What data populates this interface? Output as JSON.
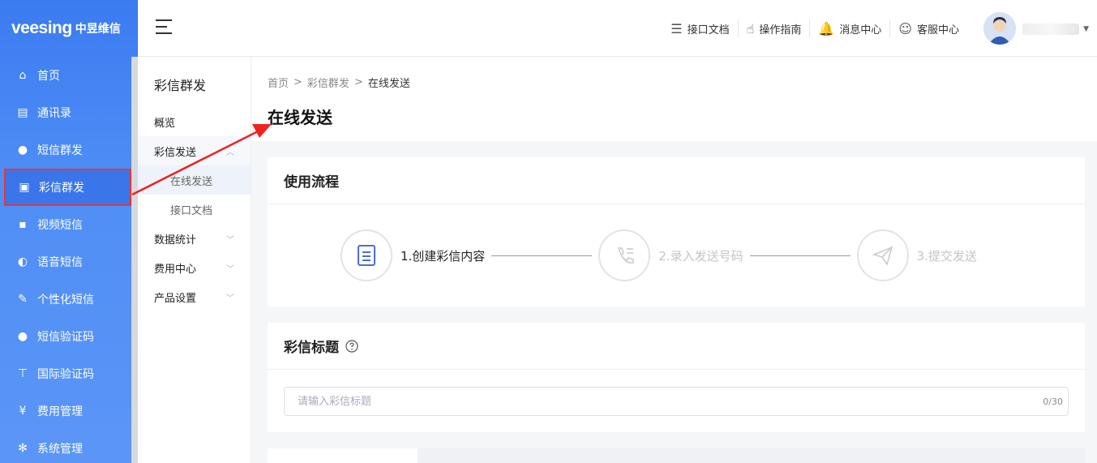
{
  "brand": {
    "logo_en": "veesing",
    "logo_cn": "中昱维信"
  },
  "sidebar": {
    "items": [
      {
        "label": "首页",
        "icon": "home-icon",
        "glyph": "⌂"
      },
      {
        "label": "通讯录",
        "icon": "contacts-icon",
        "glyph": "▤"
      },
      {
        "label": "短信群发",
        "icon": "sms-icon",
        "glyph": "●"
      },
      {
        "label": "彩信群发",
        "icon": "mms-icon",
        "glyph": "▣"
      },
      {
        "label": "视频短信",
        "icon": "video-sms-icon",
        "glyph": "▪"
      },
      {
        "label": "语音短信",
        "icon": "voice-sms-icon",
        "glyph": "◐"
      },
      {
        "label": "个性化短信",
        "icon": "personal-sms-icon",
        "glyph": "✎"
      },
      {
        "label": "短信验证码",
        "icon": "sms-code-icon",
        "glyph": "●"
      },
      {
        "label": "国际验证码",
        "icon": "intl-code-icon",
        "glyph": "⊤"
      },
      {
        "label": "费用管理",
        "icon": "billing-icon",
        "glyph": "¥"
      },
      {
        "label": "系统管理",
        "icon": "settings-icon",
        "glyph": "✻"
      }
    ],
    "active_index": 3
  },
  "header": {
    "links": [
      {
        "label": "接口文档",
        "icon": "api-doc-icon"
      },
      {
        "label": "操作指南",
        "icon": "guide-hand-icon"
      },
      {
        "label": "消息中心",
        "icon": "bell-icon"
      },
      {
        "label": "客服中心",
        "icon": "service-icon"
      }
    ]
  },
  "submenu": {
    "title": "彩信群发",
    "overview": "概览",
    "send": "彩信发送",
    "send_children": [
      "在线发送",
      "接口文档"
    ],
    "stats": "数据统计",
    "fees": "费用中心",
    "settings": "产品设置"
  },
  "breadcrumb": {
    "home": "首页",
    "section": "彩信群发",
    "current": "在线发送",
    "sep": ">"
  },
  "page_title": "在线发送",
  "flow": {
    "title": "使用流程",
    "steps": [
      {
        "label": "1.创建彩信内容",
        "state": "active"
      },
      {
        "label": "2.录入发送号码",
        "state": "inactive"
      },
      {
        "label": "3.提交发送",
        "state": "inactive"
      }
    ]
  },
  "mms_title": {
    "title": "彩信标题",
    "help_icon": "question-circle-icon",
    "placeholder": "请输入彩信标题",
    "value": "",
    "counter": "0/30"
  },
  "colors": {
    "sidebar": "#4a88f4",
    "highlight": "#ee3333"
  }
}
